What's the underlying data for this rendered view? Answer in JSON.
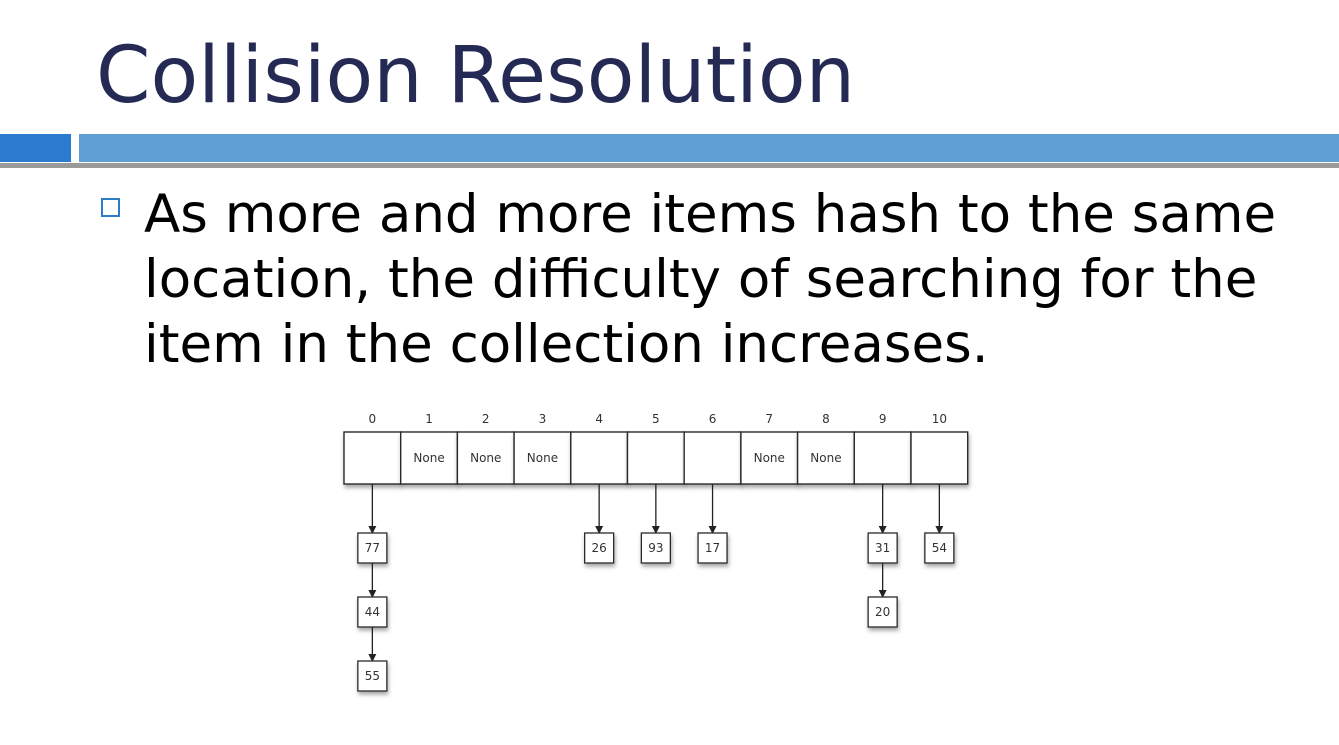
{
  "slide": {
    "title": "Collision Resolution",
    "bullet": "As more and more items hash to the same location, the difficulty of searching for the item in the collection increases."
  },
  "diagram": {
    "slots": [
      {
        "index": "0",
        "value": "",
        "chain": [
          "77",
          "44",
          "55"
        ]
      },
      {
        "index": "1",
        "value": "None",
        "chain": []
      },
      {
        "index": "2",
        "value": "None",
        "chain": []
      },
      {
        "index": "3",
        "value": "None",
        "chain": []
      },
      {
        "index": "4",
        "value": "",
        "chain": [
          "26"
        ]
      },
      {
        "index": "5",
        "value": "",
        "chain": [
          "93"
        ]
      },
      {
        "index": "6",
        "value": "",
        "chain": [
          "17"
        ]
      },
      {
        "index": "7",
        "value": "None",
        "chain": []
      },
      {
        "index": "8",
        "value": "None",
        "chain": []
      },
      {
        "index": "9",
        "value": "",
        "chain": [
          "31",
          "20"
        ]
      },
      {
        "index": "10",
        "value": "",
        "chain": [
          "54"
        ]
      }
    ]
  }
}
